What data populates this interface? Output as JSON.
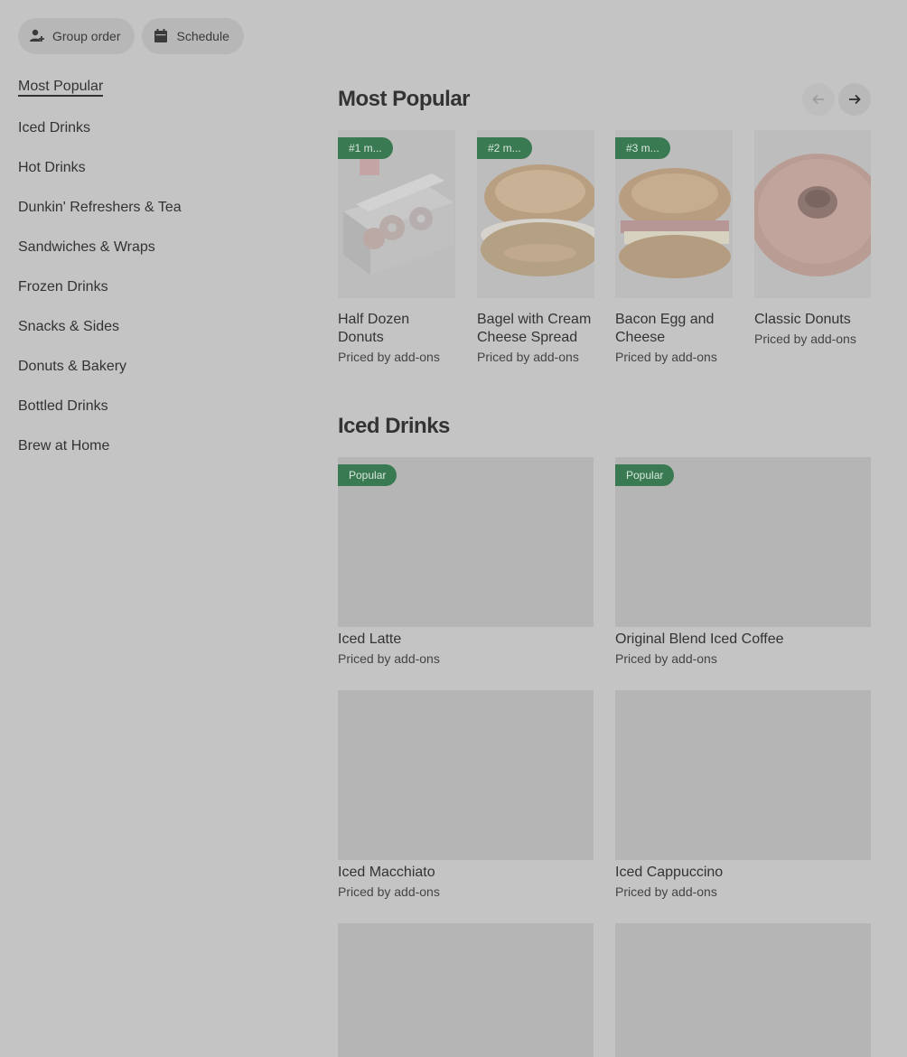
{
  "top_actions": {
    "group_order": "Group order",
    "schedule": "Schedule"
  },
  "sidebar": {
    "items": [
      {
        "label": "Most Popular"
      },
      {
        "label": "Iced Drinks"
      },
      {
        "label": "Hot Drinks"
      },
      {
        "label": "Dunkin' Refreshers & Tea"
      },
      {
        "label": "Sandwiches & Wraps"
      },
      {
        "label": "Frozen Drinks"
      },
      {
        "label": "Snacks & Sides"
      },
      {
        "label": "Donuts & Bakery"
      },
      {
        "label": "Bottled Drinks"
      },
      {
        "label": "Brew at Home"
      }
    ]
  },
  "most_popular": {
    "title": "Most Popular",
    "items": [
      {
        "badge": "#1 m...",
        "name": "Half Dozen Donuts",
        "sub": "Priced by add-ons"
      },
      {
        "badge": "#2 m...",
        "name": "Bagel with Cream Cheese Spread",
        "sub": "Priced by add-ons"
      },
      {
        "badge": "#3 m...",
        "name": "Bacon Egg and Cheese",
        "sub": "Priced by add-ons"
      },
      {
        "badge": "",
        "name": "Classic Donuts",
        "sub": "Priced by add-ons"
      }
    ]
  },
  "iced_drinks": {
    "title": "Iced Drinks",
    "items": [
      {
        "badge": "Popular",
        "name": "Iced Latte",
        "sub": "Priced by add-ons"
      },
      {
        "badge": "Popular",
        "name": "Original Blend Iced Coffee",
        "sub": "Priced by add-ons"
      },
      {
        "badge": "",
        "name": "Iced Macchiato",
        "sub": "Priced by add-ons"
      },
      {
        "badge": "",
        "name": "Iced Cappuccino",
        "sub": "Priced by add-ons"
      }
    ]
  },
  "colors": {
    "background": "#c4c4c4",
    "badge": "#3a7a52",
    "placeholder": "#b5b5b5"
  }
}
